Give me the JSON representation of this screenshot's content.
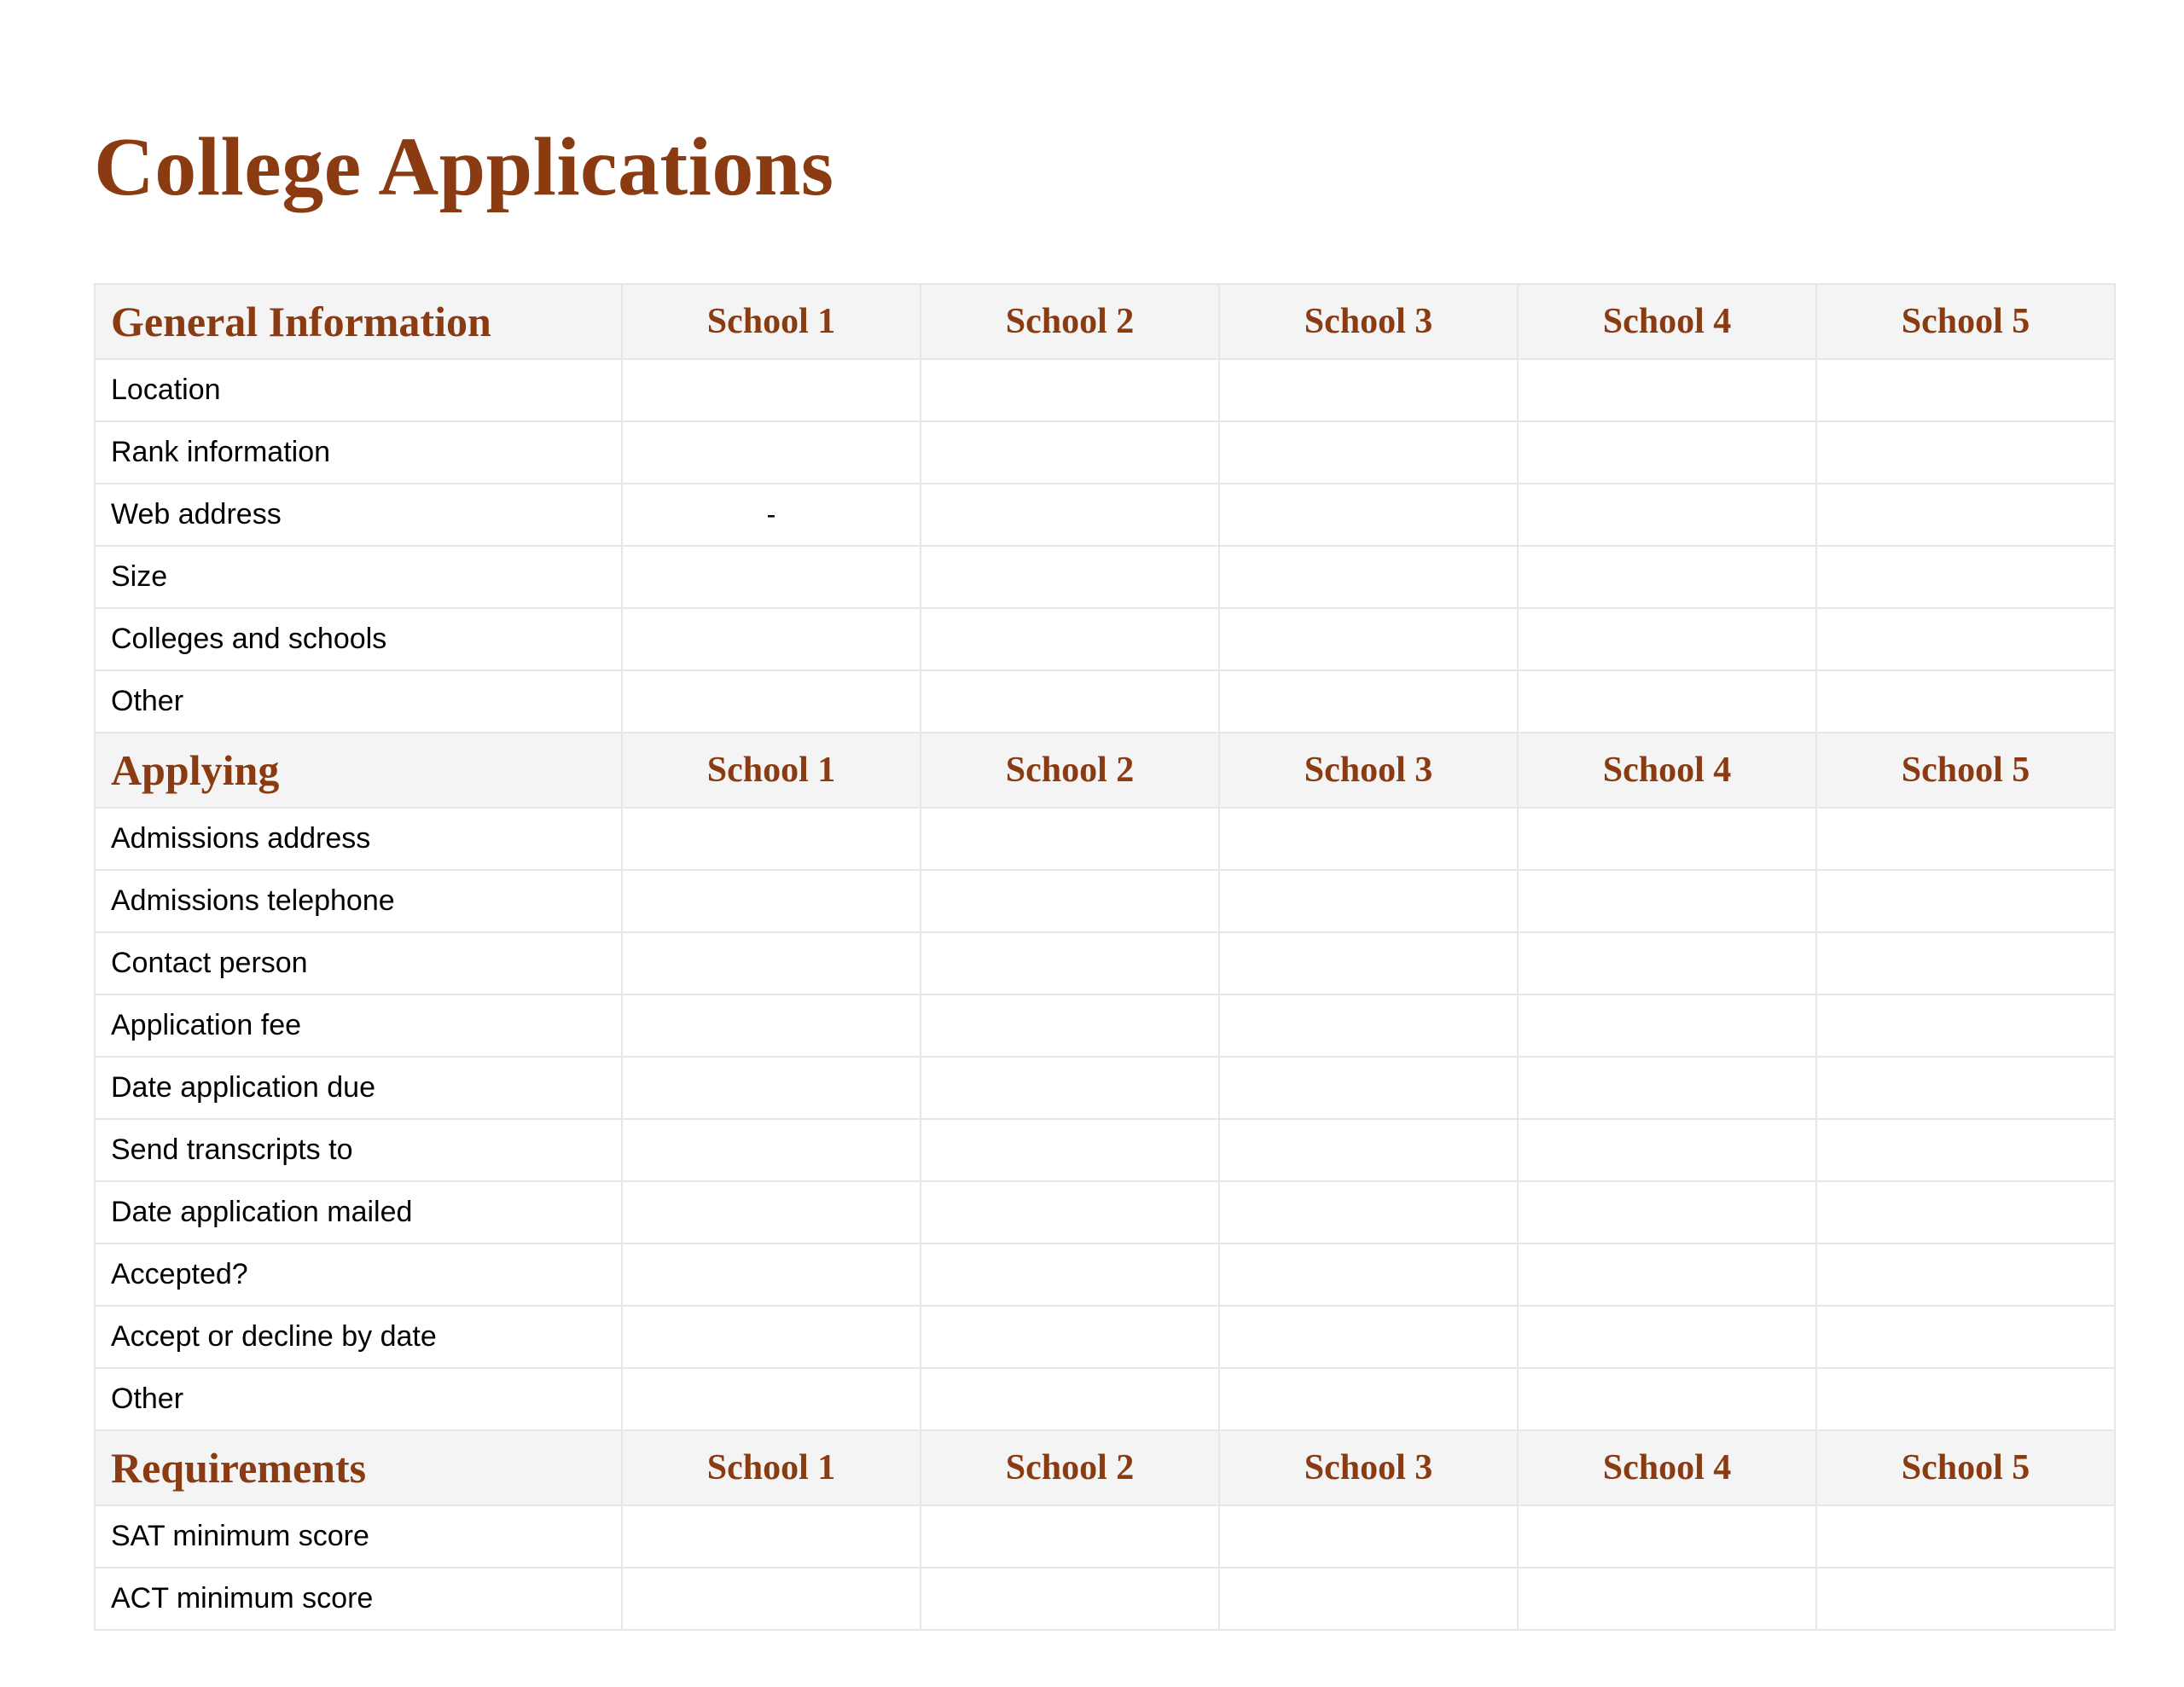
{
  "title": "College Applications",
  "columns": [
    "School 1",
    "School 2",
    "School 3",
    "School 4",
    "School 5"
  ],
  "sections": [
    {
      "name": "General Information",
      "rows": [
        {
          "label": "Location",
          "cells": [
            "",
            "",
            "",
            "",
            ""
          ]
        },
        {
          "label": "Rank information",
          "cells": [
            "",
            "",
            "",
            "",
            ""
          ]
        },
        {
          "label": "Web address",
          "cells": [
            "-",
            "",
            "",
            "",
            ""
          ]
        },
        {
          "label": "Size",
          "cells": [
            "",
            "",
            "",
            "",
            ""
          ]
        },
        {
          "label": "Colleges and schools",
          "cells": [
            "",
            "",
            "",
            "",
            ""
          ]
        },
        {
          "label": "Other",
          "cells": [
            "",
            "",
            "",
            "",
            ""
          ]
        }
      ]
    },
    {
      "name": "Applying",
      "rows": [
        {
          "label": "Admissions address",
          "cells": [
            "",
            "",
            "",
            "",
            ""
          ]
        },
        {
          "label": "Admissions telephone",
          "cells": [
            "",
            "",
            "",
            "",
            ""
          ]
        },
        {
          "label": "Contact person",
          "cells": [
            "",
            "",
            "",
            "",
            ""
          ]
        },
        {
          "label": "Application fee",
          "cells": [
            "",
            "",
            "",
            "",
            ""
          ]
        },
        {
          "label": "Date application due",
          "cells": [
            "",
            "",
            "",
            "",
            ""
          ]
        },
        {
          "label": "Send transcripts to",
          "cells": [
            "",
            "",
            "",
            "",
            ""
          ]
        },
        {
          "label": "Date application mailed",
          "cells": [
            "",
            "",
            "",
            "",
            ""
          ]
        },
        {
          "label": "Accepted?",
          "cells": [
            "",
            "",
            "",
            "",
            ""
          ]
        },
        {
          "label": "Accept or decline by date",
          "cells": [
            "",
            "",
            "",
            "",
            ""
          ]
        },
        {
          "label": "Other",
          "cells": [
            "",
            "",
            "",
            "",
            ""
          ]
        }
      ]
    },
    {
      "name": "Requirements",
      "rows": [
        {
          "label": "SAT minimum score",
          "cells": [
            "",
            "",
            "",
            "",
            ""
          ]
        },
        {
          "label": "ACT minimum score",
          "cells": [
            "",
            "",
            "",
            "",
            ""
          ]
        }
      ]
    }
  ]
}
